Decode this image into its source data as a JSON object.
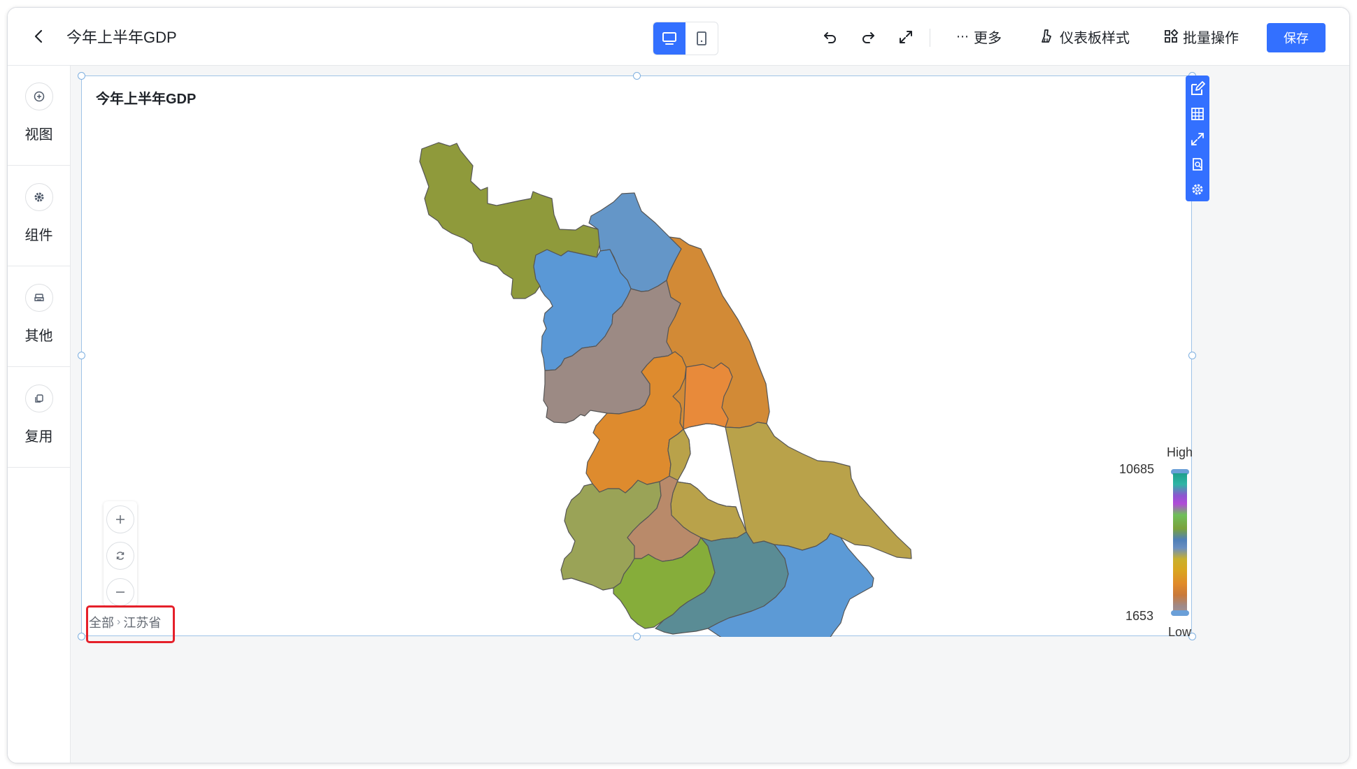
{
  "header": {
    "title": "今年上半年GDP",
    "more_label": "更多",
    "dashboard_style_label": "仪表板样式",
    "batch_ops_label": "批量操作",
    "save_label": "保存"
  },
  "sidebar": {
    "items": [
      {
        "label": "视图",
        "icon": "plus-circle-icon"
      },
      {
        "label": "组件",
        "icon": "gear-icon"
      },
      {
        "label": "其他",
        "icon": "printer-icon"
      },
      {
        "label": "复用",
        "icon": "copy-icon"
      }
    ]
  },
  "widget": {
    "title": "今年上半年GDP",
    "map_region": "江苏省"
  },
  "breadcrumb": {
    "root": "全部",
    "current": "江苏省"
  },
  "legend": {
    "high_label": "High",
    "low_label": "Low",
    "max_value": "10685",
    "min_value": "1653"
  },
  "colors": {
    "accent": "#3370ff",
    "highlight_border": "#e5202a",
    "selection_border": "#9fc3e7"
  }
}
